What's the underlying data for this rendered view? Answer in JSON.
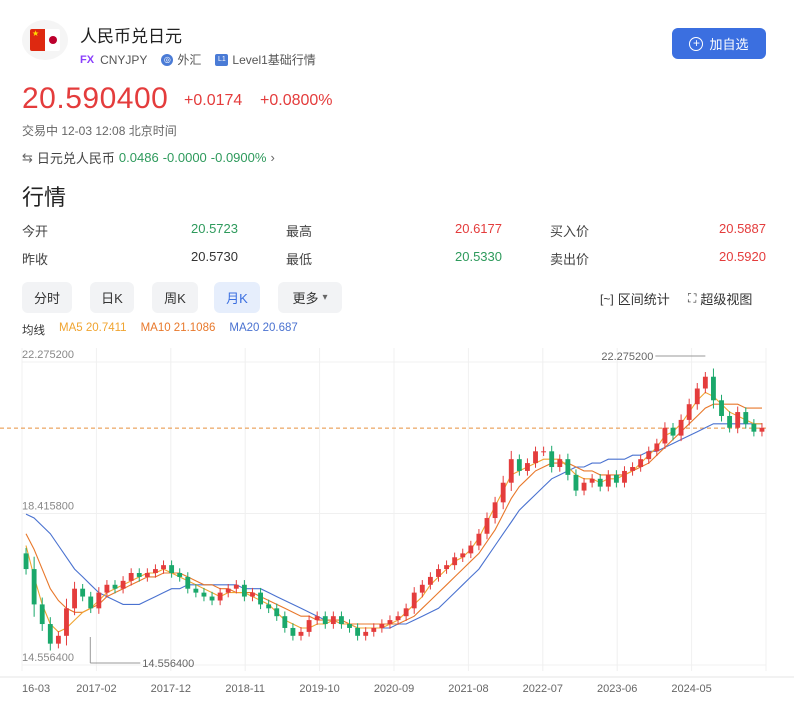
{
  "header": {
    "title": "人民币兑日元",
    "market_tag": "FX",
    "code": "CNYJPY",
    "category": "外汇",
    "level_badge": "L1",
    "level_text": "Level1基础行情",
    "add_button": "加自选"
  },
  "quote": {
    "price": "20.590400",
    "change": "+0.0174",
    "change_pct": "+0.0800%",
    "status": "交易中 12-03 12:08 北京时间",
    "inverse_label": "日元兑人民币",
    "inverse_price": "0.0486",
    "inverse_change": "-0.0000",
    "inverse_pct": "-0.0900%"
  },
  "section_title": "行情",
  "stats": [
    {
      "label": "今开",
      "value": "20.5723",
      "color": "green"
    },
    {
      "label": "最高",
      "value": "20.6177",
      "color": "red"
    },
    {
      "label": "买入价",
      "value": "20.5887",
      "color": "red"
    },
    {
      "label": "昨收",
      "value": "20.5730",
      "color": "normal"
    },
    {
      "label": "最低",
      "value": "20.5330",
      "color": "green"
    },
    {
      "label": "卖出价",
      "value": "20.5920",
      "color": "red"
    }
  ],
  "tabs": [
    "分时",
    "日K",
    "周K",
    "月K",
    "更多"
  ],
  "active_tab": "月K",
  "tools": {
    "range_stats": "区间统计",
    "super_view": "超级视图"
  },
  "ma": {
    "label": "均线",
    "ma5": "MA5 20.7411",
    "ma10": "MA10 21.1086",
    "ma20": "MA20 20.687"
  },
  "colors": {
    "up": "#e43c3c",
    "down": "#1aa86b",
    "ma5": "#f0a430",
    "ma10": "#e8782b",
    "ma20": "#4a72d0",
    "accent": "#3b6fe0"
  },
  "chart_data": {
    "type": "candlestick",
    "y_labels": [
      "22.275200",
      "18.415800",
      "14.556400"
    ],
    "max_label": "22.275200",
    "min_label": "14.556400",
    "ylim": [
      14.5564,
      22.2752
    ],
    "current_price": 20.5904,
    "x_labels": [
      "16-03",
      "2017-02",
      "2017-12",
      "2018-11",
      "2019-10",
      "2020-09",
      "2021-08",
      "2022-07",
      "2023-06",
      "2024-05"
    ],
    "close": [
      17.0,
      16.1,
      15.6,
      15.1,
      15.3,
      16.0,
      16.5,
      16.3,
      16.0,
      16.4,
      16.6,
      16.5,
      16.7,
      16.9,
      16.8,
      16.9,
      17.0,
      17.1,
      16.9,
      16.8,
      16.5,
      16.4,
      16.3,
      16.2,
      16.4,
      16.5,
      16.6,
      16.3,
      16.4,
      16.1,
      16.0,
      15.8,
      15.5,
      15.3,
      15.4,
      15.7,
      15.8,
      15.6,
      15.8,
      15.6,
      15.5,
      15.3,
      15.4,
      15.5,
      15.6,
      15.7,
      15.8,
      16.0,
      16.4,
      16.6,
      16.8,
      17.0,
      17.1,
      17.3,
      17.4,
      17.6,
      17.9,
      18.3,
      18.7,
      19.2,
      19.8,
      19.5,
      19.7,
      20.0,
      20.0,
      19.6,
      19.8,
      19.4,
      19.0,
      19.2,
      19.3,
      19.1,
      19.4,
      19.2,
      19.5,
      19.6,
      19.8,
      20.0,
      20.2,
      20.6,
      20.4,
      20.8,
      21.2,
      21.6,
      21.9,
      21.3,
      20.9,
      20.6,
      21.0,
      20.7,
      20.5,
      20.6
    ],
    "ma5": [
      17.6,
      16.8,
      16.1,
      15.6,
      15.4,
      15.5,
      15.7,
      15.9,
      16.0,
      16.2,
      16.4,
      16.5,
      16.6,
      16.7,
      16.8,
      16.9,
      16.9,
      17.0,
      16.9,
      16.8,
      16.7,
      16.6,
      16.5,
      16.4,
      16.3,
      16.4,
      16.4,
      16.4,
      16.3,
      16.2,
      16.1,
      15.9,
      15.7,
      15.6,
      15.5,
      15.5,
      15.6,
      15.6,
      15.7,
      15.6,
      15.6,
      15.5,
      15.5,
      15.5,
      15.5,
      15.6,
      15.7,
      15.9,
      16.1,
      16.3,
      16.6,
      16.8,
      17.0,
      17.2,
      17.3,
      17.5,
      17.8,
      18.2,
      18.6,
      19.0,
      19.4,
      19.5,
      19.6,
      19.7,
      19.8,
      19.8,
      19.8,
      19.6,
      19.4,
      19.3,
      19.3,
      19.2,
      19.3,
      19.3,
      19.4,
      19.5,
      19.7,
      19.9,
      20.1,
      20.4,
      20.5,
      20.7,
      21.0,
      21.3,
      21.5,
      21.4,
      21.2,
      21.0,
      20.9,
      20.8,
      20.7,
      20.7
    ],
    "ma10": [
      17.9,
      17.5,
      17.0,
      16.5,
      16.2,
      16.0,
      15.9,
      15.9,
      16.0,
      16.1,
      16.3,
      16.4,
      16.5,
      16.6,
      16.7,
      16.8,
      16.8,
      16.9,
      16.9,
      16.9,
      16.8,
      16.7,
      16.6,
      16.6,
      16.5,
      16.5,
      16.4,
      16.4,
      16.4,
      16.3,
      16.2,
      16.1,
      16.0,
      15.9,
      15.8,
      15.8,
      15.7,
      15.7,
      15.7,
      15.7,
      15.6,
      15.6,
      15.6,
      15.6,
      15.6,
      15.6,
      15.6,
      15.7,
      15.8,
      16.0,
      16.2,
      16.4,
      16.6,
      16.8,
      17.0,
      17.2,
      17.4,
      17.7,
      18.0,
      18.4,
      18.8,
      19.1,
      19.3,
      19.5,
      19.6,
      19.7,
      19.7,
      19.7,
      19.6,
      19.5,
      19.5,
      19.4,
      19.4,
      19.4,
      19.4,
      19.5,
      19.6,
      19.7,
      19.9,
      20.1,
      20.3,
      20.5,
      20.7,
      20.9,
      21.1,
      21.2,
      21.2,
      21.2,
      21.2,
      21.1,
      21.1,
      21.1
    ],
    "ma20": [
      18.4,
      18.3,
      18.1,
      17.9,
      17.6,
      17.3,
      17.0,
      16.8,
      16.6,
      16.4,
      16.3,
      16.2,
      16.1,
      16.1,
      16.1,
      16.2,
      16.3,
      16.4,
      16.5,
      16.5,
      16.6,
      16.6,
      16.6,
      16.6,
      16.6,
      16.6,
      16.6,
      16.5,
      16.5,
      16.5,
      16.4,
      16.3,
      16.2,
      16.1,
      16.0,
      15.9,
      15.8,
      15.7,
      15.7,
      15.6,
      15.6,
      15.5,
      15.5,
      15.5,
      15.5,
      15.5,
      15.6,
      15.6,
      15.7,
      15.8,
      15.9,
      16.0,
      16.2,
      16.4,
      16.6,
      16.8,
      17.0,
      17.3,
      17.6,
      17.9,
      18.2,
      18.5,
      18.7,
      18.9,
      19.1,
      19.3,
      19.4,
      19.5,
      19.6,
      19.6,
      19.7,
      19.7,
      19.8,
      19.8,
      19.8,
      19.9,
      19.9,
      20.0,
      20.0,
      20.1,
      20.2,
      20.3,
      20.4,
      20.5,
      20.6,
      20.7,
      20.7,
      20.7,
      20.7,
      20.7,
      20.7,
      20.7
    ]
  }
}
